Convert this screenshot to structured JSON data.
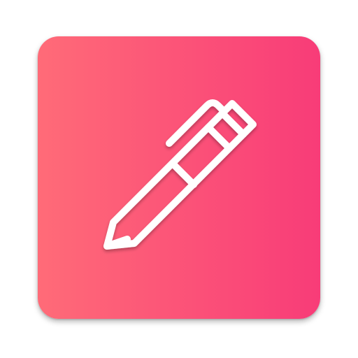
{
  "app_icon": {
    "icon": "pen-icon",
    "gradient_start": "#FF6B78",
    "gradient_end": "#F83C78",
    "glyph_color": "#FFFFFF"
  }
}
